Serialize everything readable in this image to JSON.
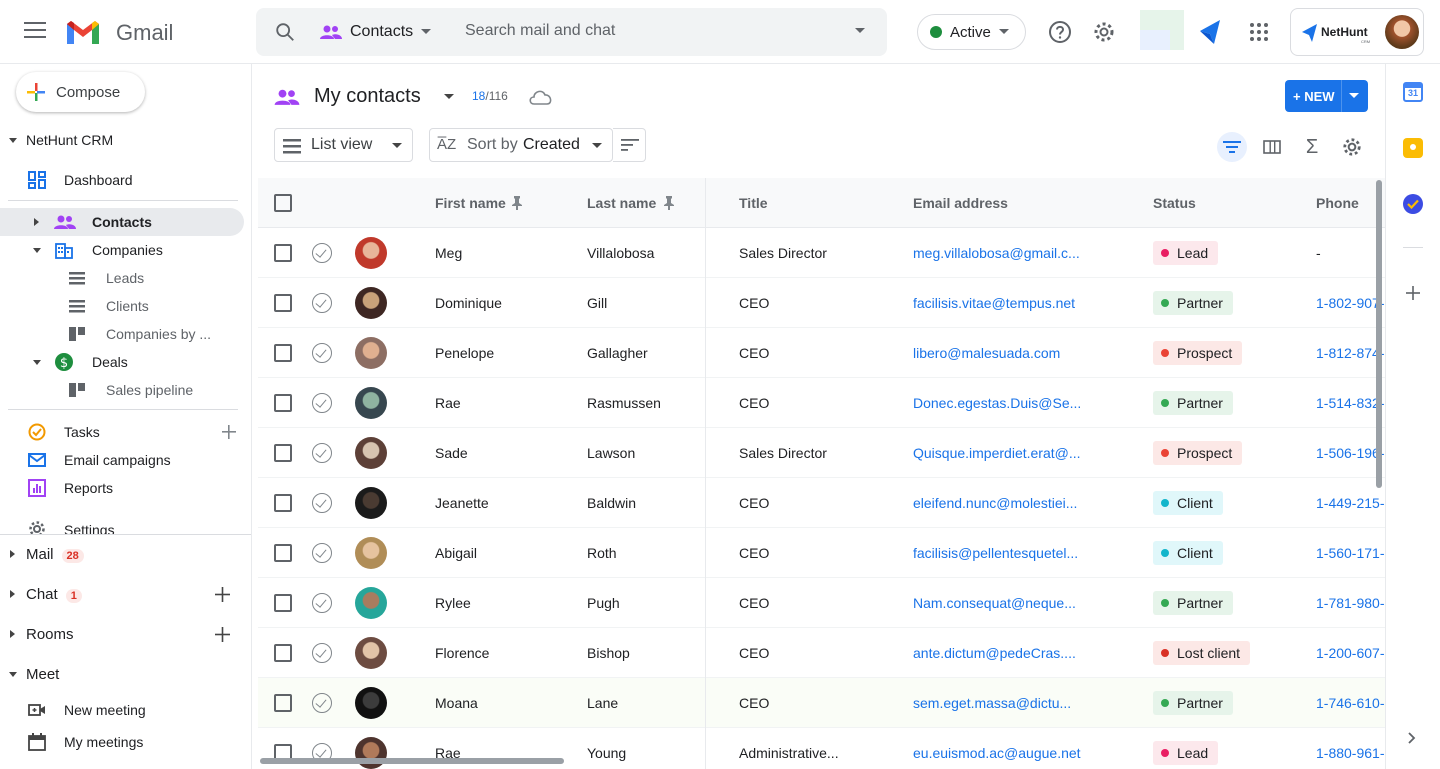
{
  "app": {
    "logo_text": "Gmail"
  },
  "search": {
    "scope": "Contacts",
    "placeholder": "Search mail and chat"
  },
  "status_pill": {
    "label": "Active",
    "color": "#1e8e3e"
  },
  "account": {
    "brand": "NetHunt",
    "brand_sub": "CRM"
  },
  "sidebar": {
    "compose": "Compose",
    "crm_section": "NetHunt CRM",
    "items": [
      {
        "label": "Dashboard",
        "icon": "dashboard-icon"
      },
      {
        "label": "Contacts",
        "icon": "contacts-icon",
        "selected": true
      },
      {
        "label": "Companies",
        "icon": "companies-icon"
      },
      {
        "label": "Leads",
        "icon": "list-view-icon"
      },
      {
        "label": "Clients",
        "icon": "list-view-icon"
      },
      {
        "label": "Companies by ...",
        "icon": "board-view-icon"
      },
      {
        "label": "Deals",
        "icon": "deals-icon"
      },
      {
        "label": "Sales pipeline",
        "icon": "board-view-icon"
      },
      {
        "label": "Tasks",
        "icon": "tasks-icon"
      },
      {
        "label": "Email campaigns",
        "icon": "email-campaigns-icon"
      },
      {
        "label": "Reports",
        "icon": "reports-icon"
      },
      {
        "label": "Settings",
        "icon": "settings-icon"
      }
    ],
    "mail": {
      "label": "Mail",
      "badge": "28"
    },
    "chat": {
      "label": "Chat",
      "badge": "1"
    },
    "rooms": {
      "label": "Rooms"
    },
    "meet": {
      "label": "Meet",
      "new_meeting": "New meeting",
      "my_meetings": "My meetings"
    }
  },
  "main": {
    "title": "My contacts",
    "count_shown": "18",
    "count_total": "/116",
    "new_button": "+ NEW",
    "view_label": "List view",
    "sort_prefix": "Sort by",
    "sort_value": "Created",
    "columns": [
      "First name",
      "Last name",
      "Title",
      "Email address",
      "Status",
      "Phone"
    ],
    "rows": [
      {
        "first": "Meg",
        "last": "Villalobosa",
        "title": "Sales Director",
        "email": "meg.villalobosa@gmail.c...",
        "status": "Lead",
        "phone": "-"
      },
      {
        "first": "Dominique",
        "last": "Gill",
        "title": "CEO",
        "email": "facilisis.vitae@tempus.net",
        "status": "Partner",
        "phone": "1-802-907-"
      },
      {
        "first": "Penelope",
        "last": "Gallagher",
        "title": "CEO",
        "email": "libero@malesuada.com",
        "status": "Prospect",
        "phone": "1-812-874-"
      },
      {
        "first": "Rae",
        "last": "Rasmussen",
        "title": "CEO",
        "email": "Donec.egestas.Duis@Se...",
        "status": "Partner",
        "phone": "1-514-832-"
      },
      {
        "first": "Sade",
        "last": "Lawson",
        "title": "Sales Director",
        "email": "Quisque.imperdiet.erat@...",
        "status": "Prospect",
        "phone": "1-506-196-"
      },
      {
        "first": "Jeanette",
        "last": "Baldwin",
        "title": "CEO",
        "email": "eleifend.nunc@molestiei...",
        "status": "Client",
        "phone": "1-449-215-"
      },
      {
        "first": "Abigail",
        "last": "Roth",
        "title": "CEO",
        "email": "facilisis@pellentesquetel...",
        "status": "Client",
        "phone": "1-560-171-"
      },
      {
        "first": "Rylee",
        "last": "Pugh",
        "title": "CEO",
        "email": "Nam.consequat@neque...",
        "status": "Partner",
        "phone": "1-781-980-"
      },
      {
        "first": "Florence",
        "last": "Bishop",
        "title": "CEO",
        "email": "ante.dictum@pedeCras....",
        "status": "Lost client",
        "phone": "1-200-607-"
      },
      {
        "first": "Moana",
        "last": "Lane",
        "title": "CEO",
        "email": "sem.eget.massa@dictu...",
        "status": "Partner",
        "phone": "1-746-610-"
      },
      {
        "first": "Rae",
        "last": "Young",
        "title": "Administrative...",
        "email": "eu.euismod.ac@augue.net",
        "status": "Lead",
        "phone": "1-880-961-"
      }
    ]
  },
  "status_colors": {
    "Lead": {
      "bg": "#fce8ec",
      "dot": "#e91e63"
    },
    "Partner": {
      "bg": "#e6f4ea",
      "dot": "#34a853"
    },
    "Prospect": {
      "bg": "#fce8e6",
      "dot": "#ea4335"
    },
    "Client": {
      "bg": "#e0f7fa",
      "dot": "#12b5cb"
    },
    "Lost client": {
      "bg": "#fce8e6",
      "dot": "#d93025"
    }
  },
  "accent": "#1a73e8"
}
